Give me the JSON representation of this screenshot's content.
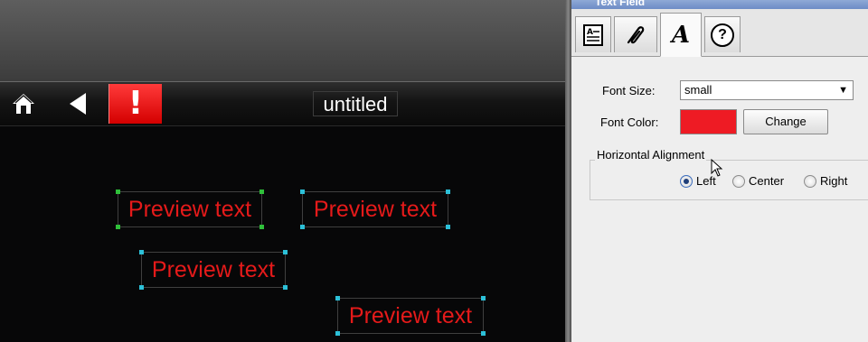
{
  "canvas": {
    "title": "untitled",
    "toolbar": {
      "home_icon": "home-icon",
      "back_icon": "back-arrow-icon",
      "alert_label": "!"
    },
    "preview_items": [
      {
        "text": "Preview text",
        "selected_style": "green-handles"
      },
      {
        "text": "Preview text",
        "selected_style": "cyan-handles"
      },
      {
        "text": "Preview text",
        "selected_style": "cyan-handles"
      },
      {
        "text": "Preview text",
        "selected_style": "cyan-handles"
      }
    ],
    "colors": {
      "preview_text": "#e51a1a",
      "alert": "#e00000",
      "background": "#070708"
    }
  },
  "panel": {
    "title": "Text Field",
    "tabs": [
      {
        "icon": "properties-icon"
      },
      {
        "icon": "link-icon"
      },
      {
        "icon": "font-icon",
        "glyph": "A",
        "active": true
      },
      {
        "icon": "help-icon",
        "glyph": "?"
      }
    ],
    "font_size": {
      "label": "Font Size:",
      "value": "small"
    },
    "font_color": {
      "label": "Font Color:",
      "value": "#ee1b24",
      "button": "Change"
    },
    "alignment": {
      "legend": "Horizontal Alignment",
      "options": [
        {
          "label": "Left",
          "selected": true
        },
        {
          "label": "Center",
          "selected": false
        },
        {
          "label": "Right",
          "selected": false
        }
      ]
    }
  }
}
